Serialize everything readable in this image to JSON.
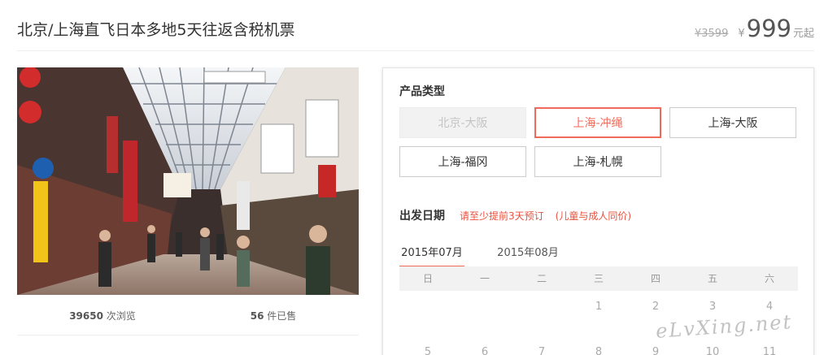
{
  "product": {
    "title": "北京/上海直飞日本多地5天往返含税机票",
    "price_old": "¥3599",
    "price_currency": "¥",
    "price_value": "999",
    "price_unit": "元起"
  },
  "stats": {
    "views_value": "39650",
    "views_label": "次浏览",
    "sold_value": "56",
    "sold_label": "件已售"
  },
  "product_type": {
    "label": "产品类型",
    "options": [
      {
        "label": "北京-大阪",
        "state": "disabled"
      },
      {
        "label": "上海-冲绳",
        "state": "selected"
      },
      {
        "label": "上海-大阪",
        "state": "normal"
      },
      {
        "label": "上海-福冈",
        "state": "normal"
      },
      {
        "label": "上海-札幌",
        "state": "normal"
      }
    ]
  },
  "departure": {
    "label": "出发日期",
    "note1": "请至少提前3天预订",
    "note2": "(儿童与成人同价)",
    "months": [
      "2015年07月",
      "2015年08月"
    ],
    "active_month": 0,
    "weekdays": [
      "日",
      "一",
      "二",
      "三",
      "四",
      "五",
      "六"
    ],
    "week1": [
      "",
      "",
      "",
      "1",
      "2",
      "3",
      "4"
    ],
    "week2": [
      "5",
      "6",
      "7",
      "8",
      "9",
      "10",
      "11"
    ]
  },
  "watermark": "eLvXing.net",
  "colors": {
    "accent": "#f06a5a",
    "note_red": "#e8533f"
  }
}
